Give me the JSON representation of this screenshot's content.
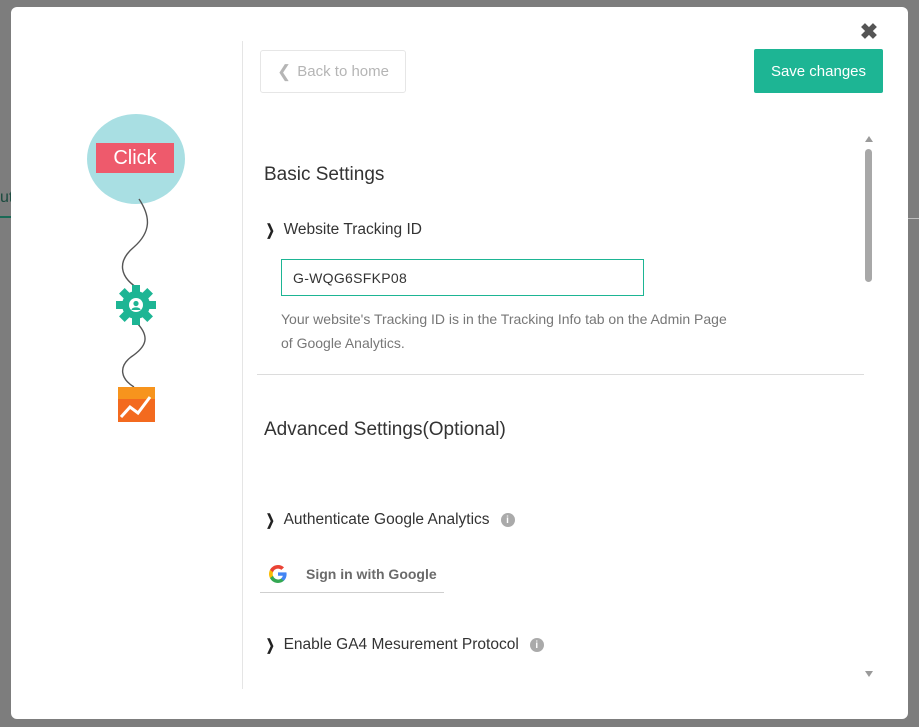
{
  "modal": {
    "close_symbol": "✖"
  },
  "flow": {
    "click_label": "Click",
    "colors": {
      "circle": "#a9dfe3",
      "label_bg": "#ee5a6c",
      "gear": "#1db594",
      "analytics": "#f36a1f"
    },
    "icons": [
      "gear-icon",
      "analytics-icon"
    ]
  },
  "toolbar": {
    "back_label": "Back to home",
    "save_label": "Save changes"
  },
  "basic": {
    "title": "Basic Settings",
    "tracking_label": "Website Tracking ID",
    "tracking_value": "G-WQG6SFKP08",
    "help": "Your website's Tracking ID is in the Tracking Info tab on the Admin Page of Google Analytics."
  },
  "advanced": {
    "title": "Advanced Settings(Optional)",
    "auth_label": "Authenticate Google Analytics",
    "google_button": "Sign in with Google",
    "ga4_label": "Enable GA4 Mesurement Protocol"
  },
  "colors": {
    "accent": "#1db594"
  }
}
